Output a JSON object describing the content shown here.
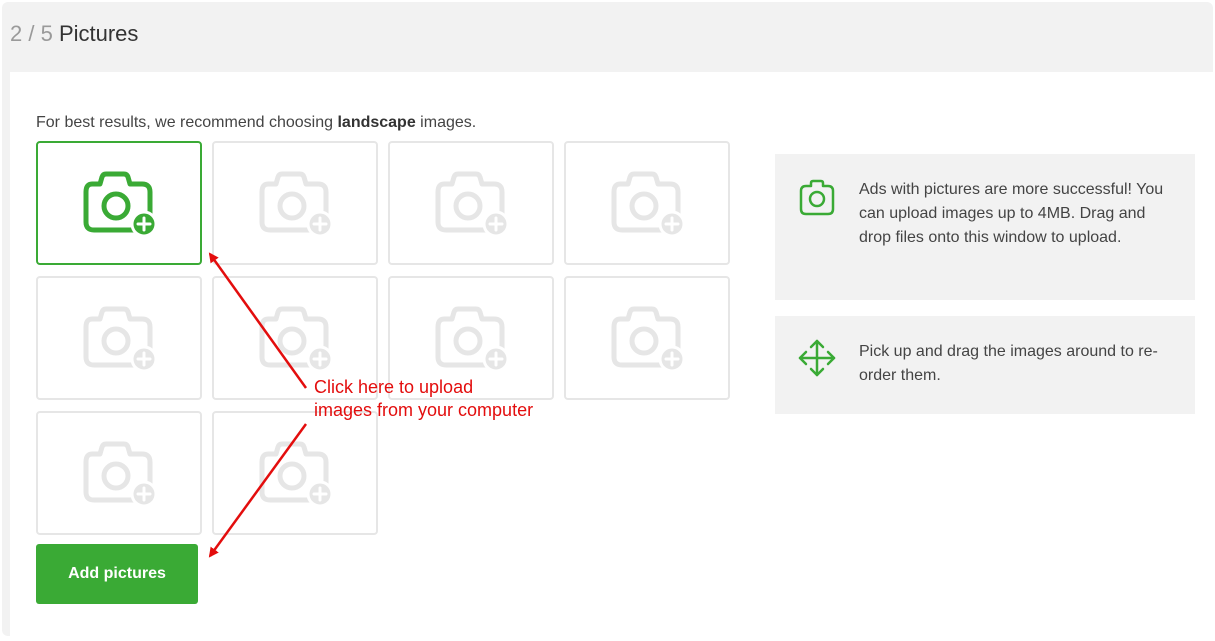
{
  "header": {
    "step": "2 / 5",
    "title": "Pictures"
  },
  "intro": {
    "before": "For best results, we recommend choosing ",
    "bold": "landscape",
    "after": " images."
  },
  "tiles": {
    "count": 10,
    "icon": "camera-plus-icon",
    "active_index": 0
  },
  "add_button": {
    "label": "Add pictures"
  },
  "info": {
    "upload_icon": "camera-icon",
    "upload_text": "Ads with pictures are more successful! You can upload images up to 4MB. Drag and drop files onto this window to upload.",
    "reorder_icon": "move-arrows-icon",
    "reorder_text": "Pick up and drag the images around to re-order them."
  },
  "annotation": {
    "text": "Click here to upload images from your computer"
  },
  "colors": {
    "accent": "#3aaa35",
    "annotation": "#e30d0d",
    "panel": "#f2f2f2",
    "tile_border": "#e6e6e6"
  }
}
